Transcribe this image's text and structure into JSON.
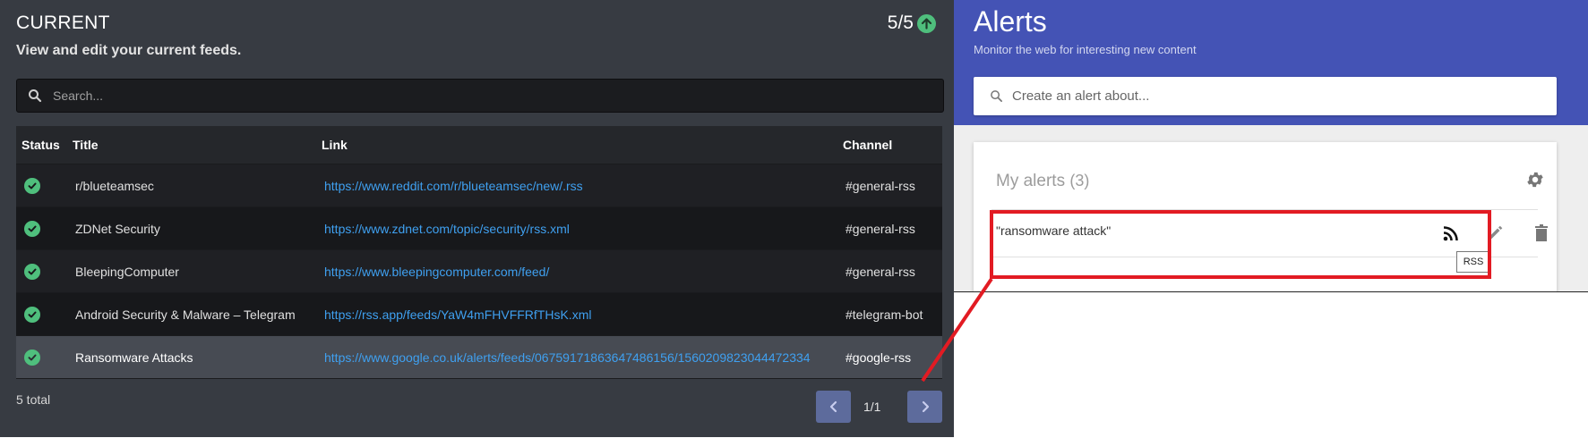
{
  "feeds": {
    "title": "CURRENT",
    "subtitle": "View and edit your current feeds.",
    "counter": "5/5",
    "search_placeholder": "Search...",
    "columns": {
      "status": "Status",
      "title": "Title",
      "link": "Link",
      "channel": "Channel"
    },
    "rows": [
      {
        "title": "r/blueteamsec",
        "link": "https://www.reddit.com/r/blueteamsec/new/.rss",
        "channel": "#general-rss"
      },
      {
        "title": "ZDNet Security",
        "link": "https://www.zdnet.com/topic/security/rss.xml",
        "channel": "#general-rss"
      },
      {
        "title": "BleepingComputer",
        "link": "https://www.bleepingcomputer.com/feed/",
        "channel": "#general-rss"
      },
      {
        "title": "Android Security & Malware – Telegram",
        "link": "https://rss.app/feeds/YaW4mFHVFFRfTHsK.xml",
        "channel": "#telegram-bot"
      },
      {
        "title": "Ransomware Attacks",
        "link": "https://www.google.co.uk/alerts/feeds/06759171863647486156/1560209823044472334",
        "channel": "#google-rss"
      }
    ],
    "total": "5 total",
    "page": "1/1",
    "colors": {
      "accent_green": "#4fbf7d",
      "link": "#3fa0f0",
      "pager": "#5d6b9c"
    }
  },
  "alerts": {
    "title": "Alerts",
    "subtitle": "Monitor the web for interesting new content",
    "create_placeholder": "Create an alert about...",
    "card_title": "My alerts",
    "card_count": "(3)",
    "item_text": "\"ransomware attack\"",
    "tooltip": "RSS",
    "colors": {
      "header_bg": "#4453b5",
      "highlight": "#e21b23"
    }
  }
}
